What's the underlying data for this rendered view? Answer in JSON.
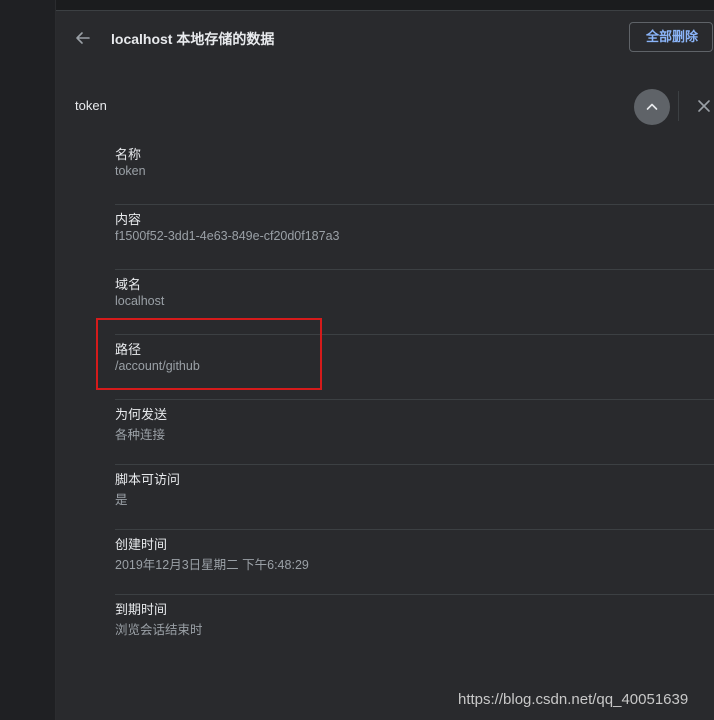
{
  "header": {
    "back_icon": "arrow-left-icon",
    "title": "localhost 本地存储的数据",
    "delete_all_label": "全部删除"
  },
  "cookie": {
    "name": "token",
    "collapse_icon": "chevron-up-icon",
    "close_icon": "close-icon"
  },
  "details": [
    {
      "label": "名称",
      "value": "token"
    },
    {
      "label": "内容",
      "value": "f1500f52-3dd1-4e63-849e-cf20d0f187a3"
    },
    {
      "label": "域名",
      "value": "localhost"
    },
    {
      "label": "路径",
      "value": "/account/github"
    },
    {
      "label": "为何发送",
      "value": "各种连接"
    },
    {
      "label": "脚本可访问",
      "value": "是"
    },
    {
      "label": "创建时间",
      "value": "2019年12月3日星期二 下午6:48:29"
    },
    {
      "label": "到期时间",
      "value": "浏览会话结束时"
    }
  ],
  "annotation": {
    "highlight_color": "#d51b1b"
  },
  "colors": {
    "background": "#292a2d",
    "accent": "#8ab4f8",
    "text_primary": "#e8eaed",
    "text_secondary": "#9aa0a6"
  },
  "watermark": "https://blog.csdn.net/qq_40051639"
}
